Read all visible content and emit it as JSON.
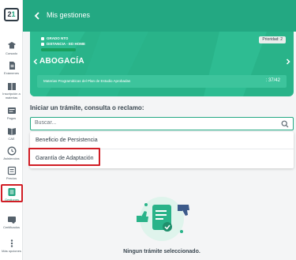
{
  "brand": {
    "logo_text_a": "2",
    "logo_text_b": "1"
  },
  "sidebar": {
    "items": [
      {
        "label": "Cursado",
        "icon": "school-icon"
      },
      {
        "label": "Exámenes",
        "icon": "document-icon"
      },
      {
        "label": "Inscripción a materias",
        "icon": "book-icon"
      },
      {
        "label": "Pagos",
        "icon": "wallet-icon"
      },
      {
        "label": "CAE",
        "icon": "book-open-icon"
      },
      {
        "label": "Asistencias",
        "icon": "clock-icon"
      },
      {
        "label": "Precios",
        "icon": "card-icon"
      },
      {
        "label": "Gestiones",
        "icon": "list-icon"
      },
      {
        "label": "Certificados",
        "icon": "certificate-icon"
      },
      {
        "label": "Más opciones",
        "icon": "more-icon"
      }
    ]
  },
  "header": {
    "title": "Mis gestiones",
    "back_icon": "chevron-left-icon"
  },
  "card": {
    "info": [
      {
        "text": "GRADO NTO"
      },
      {
        "text": "DISTANCIA - ED HOME"
      }
    ],
    "progress_fraction": 1.0,
    "priority_label": "Prioridad: 2",
    "career": "ABOGACÍA",
    "subjects_label": "Materias Programáticas del Plan de Estudio Aprobadas",
    "subjects_value": ": 37/42"
  },
  "main": {
    "section_title": "Iniciar un trámite, consulta o reclamo:",
    "search": {
      "value": "Buscar...",
      "icon": "search-icon"
    },
    "options": [
      {
        "label": "Beneficio de Persistencia"
      },
      {
        "label": "Garantía de Adaptación"
      }
    ],
    "empty_text": "Ningun trámite seleccionado."
  },
  "colors": {
    "primary": "#23a882",
    "card": "#29b389",
    "highlight": "#d11d25"
  }
}
